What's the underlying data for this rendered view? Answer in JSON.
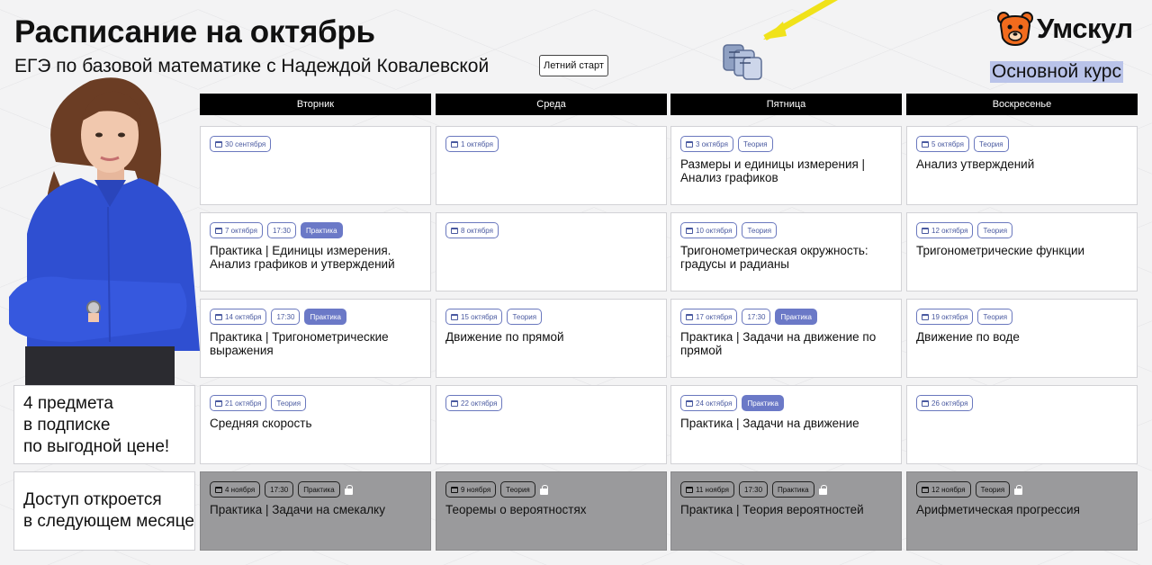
{
  "header": {
    "title": "Расписание на октябрь",
    "subtitle": "ЕГЭ по базовой математике с Надеждой Ковалевской",
    "season_chip": "Летний старт",
    "brand_name": "Умскул",
    "course_label": "Основной курс"
  },
  "sidebar": {
    "promo_lines": [
      "4 предмета",
      "в подписке",
      "по выгодной цене!"
    ],
    "access_lines": [
      "Доступ откроется",
      "в следующем месяце"
    ]
  },
  "days": [
    "Вторник",
    "Среда",
    "Пятница",
    "Воскресенье"
  ],
  "rows": [
    [
      {
        "date": "30 сентября",
        "time": "",
        "type": "",
        "title": ""
      },
      {
        "date": "1 октября",
        "time": "",
        "type": "",
        "title": ""
      },
      {
        "date": "3 октября",
        "time": "",
        "type": "Теория",
        "title": "Размеры и единицы измерения | Анализ графиков"
      },
      {
        "date": "5 октября",
        "time": "",
        "type": "Теория",
        "title": "Анализ утверждений"
      }
    ],
    [
      {
        "date": "7 октября",
        "time": "17:30",
        "type": "Практика",
        "title": "Практика | Единицы измерения. Анализ графиков и утверждений"
      },
      {
        "date": "8 октября",
        "time": "",
        "type": "",
        "title": ""
      },
      {
        "date": "10 октября",
        "time": "",
        "type": "Теория",
        "title": "Тригонометрическая окружность: градусы и радианы"
      },
      {
        "date": "12 октября",
        "time": "",
        "type": "Теория",
        "title": "Тригонометрические функции"
      }
    ],
    [
      {
        "date": "14 октября",
        "time": "17:30",
        "type": "Практика",
        "title": "Практика | Тригонометрические выражения"
      },
      {
        "date": "15 октября",
        "time": "",
        "type": "Теория",
        "title": "Движение по прямой"
      },
      {
        "date": "17 октября",
        "time": "17:30",
        "type": "Практика",
        "title": "Практика | Задачи на движение по прямой"
      },
      {
        "date": "19 октября",
        "time": "",
        "type": "Теория",
        "title": "Движение по воде"
      }
    ],
    [
      {
        "date": "21 октября",
        "time": "",
        "type": "Теория",
        "title": "Средняя скорость"
      },
      {
        "date": "22 октября",
        "time": "",
        "type": "",
        "title": ""
      },
      {
        "date": "24 октября",
        "time": "",
        "type": "Практика",
        "title": "Практика | Задачи на движение"
      },
      {
        "date": "26 октября",
        "time": "",
        "type": "",
        "title": ""
      }
    ],
    [
      {
        "date": "4 ноября",
        "time": "17:30",
        "type": "Практика",
        "title": "Практика | Задачи на смекалку",
        "locked": true
      },
      {
        "date": "9 ноября",
        "time": "",
        "type": "Теория",
        "title": "Теоремы о вероятностях",
        "locked": true
      },
      {
        "date": "11 ноября",
        "time": "17:30",
        "type": "Практика",
        "title": "Практика | Теория вероятностей",
        "locked": true
      },
      {
        "date": "12 ноября",
        "time": "",
        "type": "Теория",
        "title": "Арифметическая прогрессия",
        "locked": true
      }
    ]
  ],
  "colors": {
    "accent": "#6b79c7",
    "course_highlight": "#b9c3e9",
    "locked_cell": "#9a9a9c",
    "brand_orange": "#f26b1d"
  },
  "icons": {
    "date_icon": "calendar-icon",
    "locked_icon": "lock-icon",
    "brand_icon": "bear-logo-icon"
  }
}
